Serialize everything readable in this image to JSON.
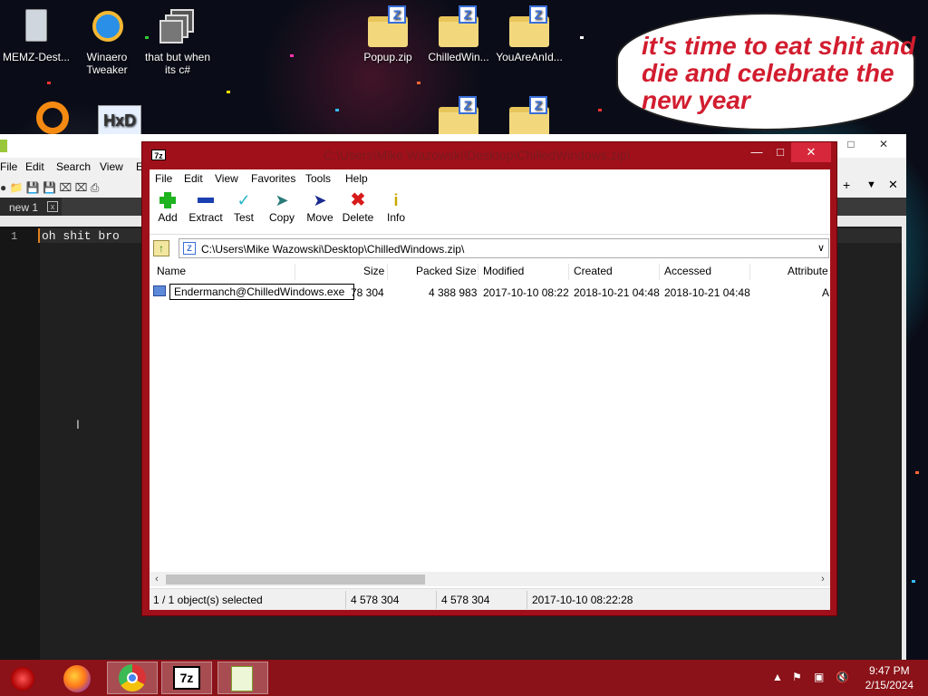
{
  "desktop": {
    "icons": [
      {
        "label": "MEMZ-Dest..."
      },
      {
        "label": "Winaero Tweaker"
      },
      {
        "label": "that but when its c#"
      },
      {
        "label": "Popup.zip"
      },
      {
        "label": "ChilledWin..."
      },
      {
        "label": "YouAreAnId..."
      }
    ],
    "bubble_text": "it's time to eat shit and die and celebrate the new year"
  },
  "notepad": {
    "menu": [
      "File",
      "Edit",
      "Search",
      "View",
      "E"
    ],
    "tab_label": "new 1",
    "line_number": "1",
    "code_line": "oh shit bro"
  },
  "sevenzip": {
    "title": "C:\\Users\\Mike Wazowski\\Desktop\\ChilledWindows.zip\\",
    "menu": [
      "File",
      "Edit",
      "View",
      "Favorites",
      "Tools",
      "Help"
    ],
    "toolbar": [
      {
        "label": "Add",
        "icon": "add-icon",
        "color": "#1fb31f"
      },
      {
        "label": "Extract",
        "icon": "extract-icon",
        "color": "#1a3fb0"
      },
      {
        "label": "Test",
        "icon": "test-icon",
        "color": "#29b8c8"
      },
      {
        "label": "Copy",
        "icon": "copy-icon",
        "color": "#2a7a7a"
      },
      {
        "label": "Move",
        "icon": "move-icon",
        "color": "#1a2a90"
      },
      {
        "label": "Delete",
        "icon": "delete-icon",
        "color": "#d81a1a"
      },
      {
        "label": "Info",
        "icon": "info-icon",
        "color": "#c8a800"
      }
    ],
    "address": "C:\\Users\\Mike Wazowski\\Desktop\\ChilledWindows.zip\\",
    "columns": [
      "Name",
      "Size",
      "Packed Size",
      "Modified",
      "Created",
      "Accessed",
      "Attribute"
    ],
    "rows": [
      {
        "name": "Endermanch@ChilledWindows.exe",
        "size": "78 304",
        "packed": "4 388 983",
        "modified": "2017-10-10 08:22",
        "created": "2018-10-21 04:48",
        "accessed": "2018-10-21 04:48",
        "attr": "A"
      }
    ],
    "status": {
      "selection": "1 / 1 object(s) selected",
      "size": "4 578 304",
      "packed": "4 578 304",
      "date": "2017-10-10 08:22:28"
    },
    "title_bg": "#a0101a"
  },
  "taskbar": {
    "clock_time": "9:47 PM",
    "clock_date": "2/15/2024",
    "color": "#8a1218"
  }
}
